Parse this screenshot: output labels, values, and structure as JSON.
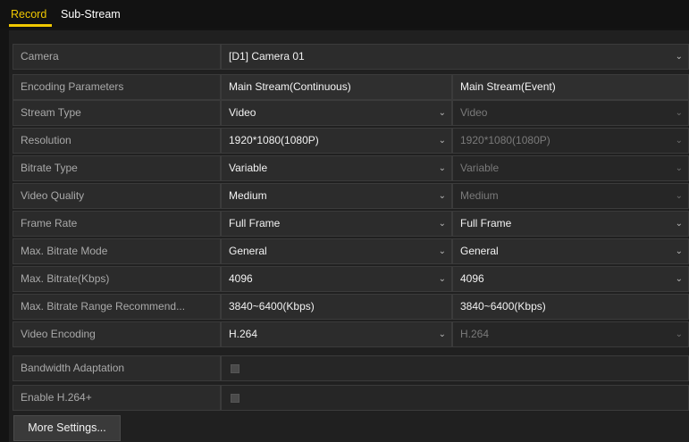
{
  "tabs": [
    {
      "label": "Record",
      "active": true
    },
    {
      "label": "Sub-Stream",
      "active": false
    }
  ],
  "camera": {
    "label": "Camera",
    "value": "[D1] Camera 01"
  },
  "header": {
    "label": "Encoding Parameters",
    "col1": "Main Stream(Continuous)",
    "col2": "Main Stream(Event)"
  },
  "rows": [
    {
      "label": "Stream Type",
      "col1": "Video",
      "col2": "Video"
    },
    {
      "label": "Resolution",
      "col1": "1920*1080(1080P)",
      "col2": "1920*1080(1080P)"
    },
    {
      "label": "Bitrate Type",
      "col1": "Variable",
      "col2": "Variable"
    },
    {
      "label": "Video Quality",
      "col1": "Medium",
      "col2": "Medium"
    },
    {
      "label": "Frame Rate",
      "col1": "Full Frame",
      "col2": "Full Frame"
    },
    {
      "label": "Max. Bitrate Mode",
      "col1": "General",
      "col2": "General"
    },
    {
      "label": "Max. Bitrate(Kbps)",
      "col1": "4096",
      "col2": "4096"
    },
    {
      "label": "Max. Bitrate Range Recommend...",
      "col1": "3840~6400(Kbps)",
      "col2": "3840~6400(Kbps)"
    },
    {
      "label": "Video Encoding",
      "col1": "H.264",
      "col2": "H.264"
    }
  ],
  "bandwidth": {
    "label": "Bandwidth Adaptation",
    "checked": false
  },
  "h264plus": {
    "label": "Enable H.264+",
    "checked": false
  },
  "more_button": "More Settings...",
  "caret_glyph": "⌄"
}
